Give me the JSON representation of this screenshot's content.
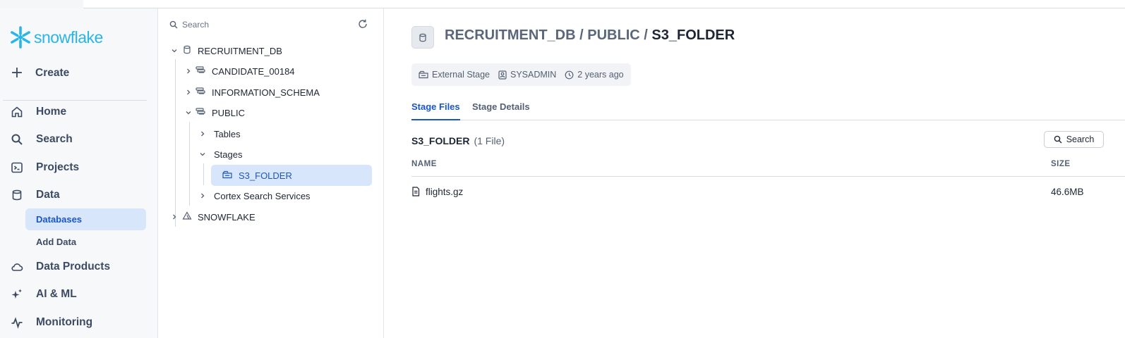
{
  "brand": {
    "name": "snowflake",
    "color": "#29b5e8"
  },
  "nav": {
    "create": "Create",
    "items": [
      {
        "label": "Home",
        "icon": "home-icon"
      },
      {
        "label": "Search",
        "icon": "search-icon"
      },
      {
        "label": "Projects",
        "icon": "terminal-icon"
      },
      {
        "label": "Data",
        "icon": "database-icon"
      },
      {
        "label": "Data Products",
        "icon": "cloud-icon"
      },
      {
        "label": "AI & ML",
        "icon": "sparkle-icon"
      },
      {
        "label": "Monitoring",
        "icon": "activity-icon"
      }
    ],
    "data_sub": [
      {
        "label": "Databases",
        "active": true
      },
      {
        "label": "Add Data",
        "active": false
      }
    ]
  },
  "tree": {
    "search_placeholder": "Search",
    "nodes": {
      "db": "RECRUITMENT_DB",
      "schema1": "CANDIDATE_00184",
      "schema2": "INFORMATION_SCHEMA",
      "schema3": "PUBLIC",
      "tables": "Tables",
      "stages": "Stages",
      "stage": "S3_FOLDER",
      "cortex": "Cortex Search Services",
      "db2": "SNOWFLAKE"
    }
  },
  "main": {
    "breadcrumb": {
      "db": "RECRUITMENT_DB",
      "sep": "/",
      "schema": "PUBLIC",
      "object": "S3_FOLDER"
    },
    "meta": {
      "type": "External Stage",
      "owner": "SYSADMIN",
      "age": "2 years ago"
    },
    "tabs": [
      "Stage Files",
      "Stage Details"
    ],
    "section_title": "S3_FOLDER",
    "section_count": "(1 File)",
    "search_button": "Search",
    "columns": {
      "name": "NAME",
      "size": "SIZE"
    },
    "files": [
      {
        "name": "flights.gz",
        "size": "46.6MB"
      }
    ]
  },
  "colors": {
    "accent": "#1a56c5",
    "selected_bg": "#d8e6fc"
  }
}
